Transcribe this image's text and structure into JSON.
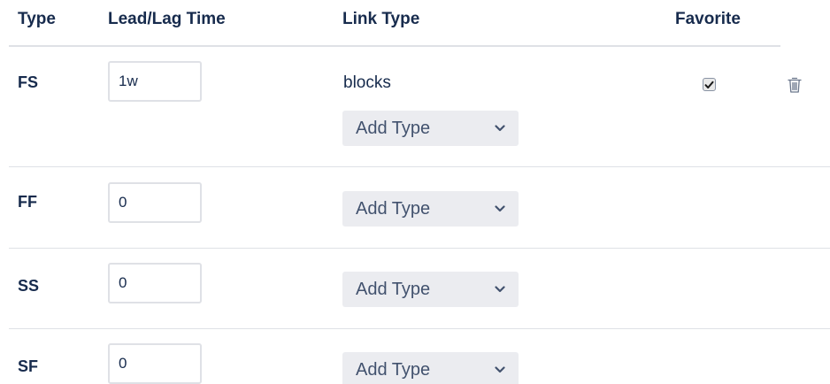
{
  "columns": {
    "type": "Type",
    "lead_lag": "Lead/Lag Time",
    "link_type": "Link Type",
    "favorite": "Favorite"
  },
  "rows": [
    {
      "type": "FS",
      "lead_lag_value": "1w",
      "links": [
        "blocks"
      ],
      "add_type_label": "Add Type",
      "favorite_checked": true,
      "has_delete": true
    },
    {
      "type": "FF",
      "lead_lag_value": "0",
      "links": [],
      "add_type_label": "Add Type",
      "favorite_checked": false,
      "has_delete": false
    },
    {
      "type": "SS",
      "lead_lag_value": "0",
      "links": [],
      "add_type_label": "Add Type",
      "favorite_checked": false,
      "has_delete": false
    },
    {
      "type": "SF",
      "lead_lag_value": "0",
      "links": [],
      "add_type_label": "Add Type",
      "favorite_checked": false,
      "has_delete": false
    }
  ],
  "icons": {
    "dropdown": "chevron-down-icon",
    "favorite": "checkbox-icon",
    "delete": "trash-icon"
  },
  "colors": {
    "text": "#172b4d",
    "divider": "#dfe1e6",
    "select_bg": "#ebecf0",
    "select_text": "#42526e"
  }
}
